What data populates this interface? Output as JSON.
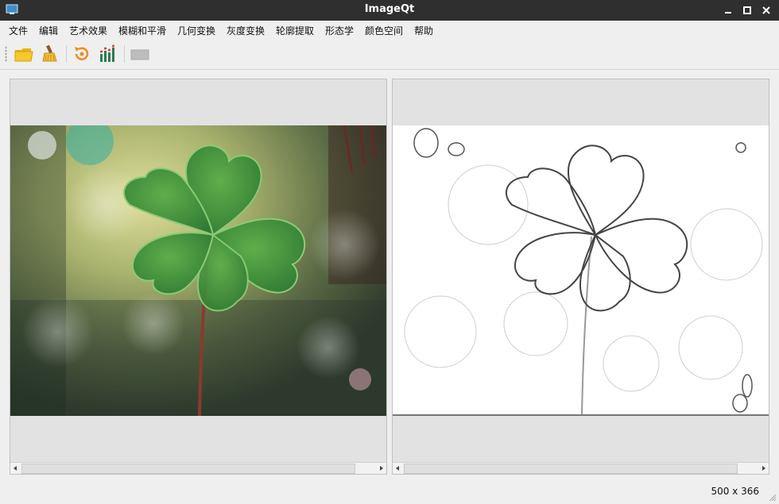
{
  "window": {
    "title": "ImageQt"
  },
  "menu": [
    "文件",
    "编辑",
    "艺术效果",
    "模糊和平滑",
    "几何变换",
    "灰度变换",
    "轮廓提取",
    "形态学",
    "颜色空间",
    "帮助"
  ],
  "toolbar": {
    "icons": [
      "open-folder-icon",
      "clear-brush-icon",
      "restore-icon",
      "histogram-icon",
      "disabled-tool-icon"
    ]
  },
  "status": {
    "image_size": "500 x 366"
  },
  "colors": {
    "titlebar": "#2f2f2f",
    "panel_bg": "#e2e2e2",
    "accent_orange": "#f08a1c"
  }
}
